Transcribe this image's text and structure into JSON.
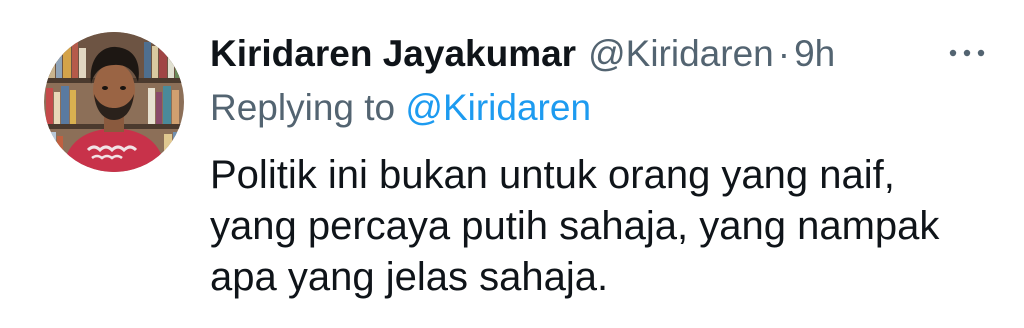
{
  "tweet": {
    "author": {
      "name": "Kiridaren Jayakumar",
      "handle": "@Kiridaren"
    },
    "separator": "·",
    "time": "9h",
    "reply": {
      "prefix": "Replying to",
      "handle": "@Kiridaren"
    },
    "text_lines": [
      "Politik ini bukan untuk orang yang naif,",
      "yang percaya putih sahaja, yang nampak",
      "apa yang jelas sahaja."
    ]
  },
  "icons": {
    "more": "more-horizontal-icon",
    "avatar": "profile-photo"
  },
  "colors": {
    "primary_text": "#0f1419",
    "secondary_text": "#536471",
    "link": "#1d9bf0",
    "background": "#ffffff"
  }
}
